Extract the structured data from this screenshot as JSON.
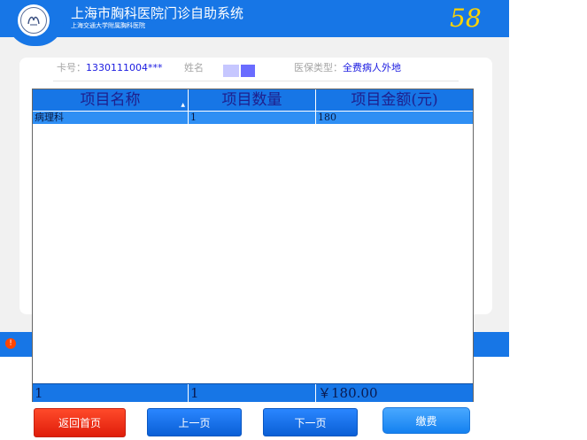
{
  "header": {
    "title": "上海市胸科医院门诊自助系统",
    "subtitle": "上海交通大学附属胸科医院",
    "countdown": "58",
    "logo_icon": "hospital-seal-logo"
  },
  "patient_info": {
    "card_label": "卡号：",
    "card_value": "1330111004***",
    "name_label": "姓名",
    "insurance_label": "医保类型：",
    "insurance_value": "全费病人外地"
  },
  "table": {
    "columns": [
      "项目名称",
      "项目数量",
      "项目金额(元)"
    ],
    "rows": [
      [
        "病理科",
        "1",
        "180"
      ]
    ],
    "footer": [
      "1",
      "1",
      "￥180.00"
    ]
  },
  "buttons": {
    "home": "返回首页",
    "prev": "上一页",
    "next": "下一页",
    "pay": "缴费"
  },
  "colors": {
    "primary": "#1776e6",
    "countdown": "#ffd400",
    "danger": "#e01d0a",
    "selected_row": "#2f8ff4"
  }
}
